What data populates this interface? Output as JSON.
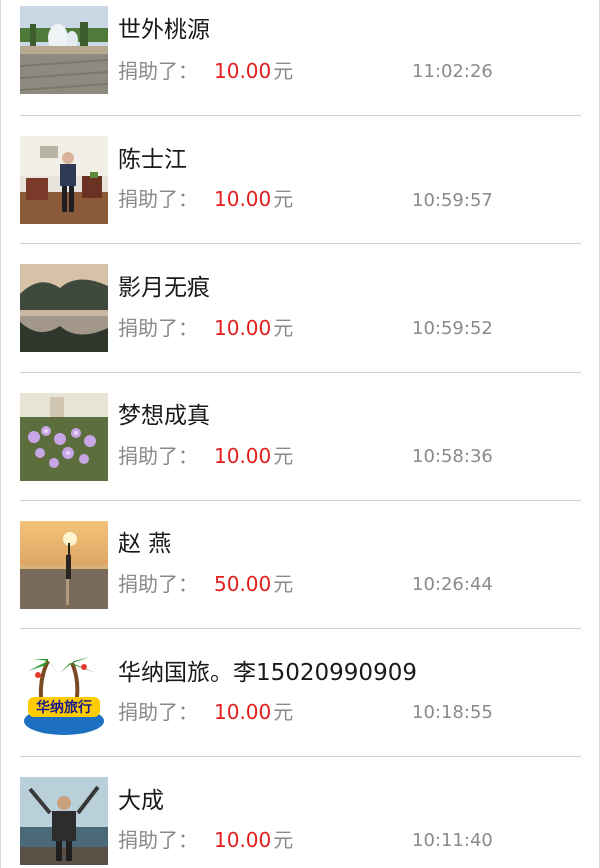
{
  "donations": [
    {
      "name": "世外桃源",
      "label": "捐助了：",
      "amount": "10.00",
      "unit": "元",
      "time": "11:02:26",
      "avatar_icon": "fountain-plaza-photo"
    },
    {
      "name": "陈士江",
      "label": "捐助了：",
      "amount": "10.00",
      "unit": "元",
      "time": "10:59:57",
      "avatar_icon": "man-in-office-photo"
    },
    {
      "name": "影月无痕",
      "label": "捐助了：",
      "amount": "10.00",
      "unit": "元",
      "time": "10:59:52",
      "avatar_icon": "lake-mountain-photo"
    },
    {
      "name": "梦想成真",
      "label": "捐助了：",
      "amount": "10.00",
      "unit": "元",
      "time": "10:58:36",
      "avatar_icon": "flowers-photo"
    },
    {
      "name": "赵 燕",
      "label": "捐助了：",
      "amount": "50.00",
      "unit": "元",
      "time": "10:26:44",
      "avatar_icon": "sunset-beach-photo"
    },
    {
      "name": "华纳国旅。李15020990909",
      "label": "捐助了：",
      "amount": "10.00",
      "unit": "元",
      "time": "10:18:55",
      "avatar_icon": "travel-agency-logo"
    },
    {
      "name": "大成",
      "label": "捐助了：",
      "amount": "10.00",
      "unit": "元",
      "time": "10:11:40",
      "avatar_icon": "man-on-boat-photo"
    }
  ],
  "logo_text": "华纳旅行",
  "colors": {
    "amount": "#e21e1e",
    "label": "#8a8a8a",
    "name": "#1a1a1a",
    "divider": "#cfcfcf"
  }
}
